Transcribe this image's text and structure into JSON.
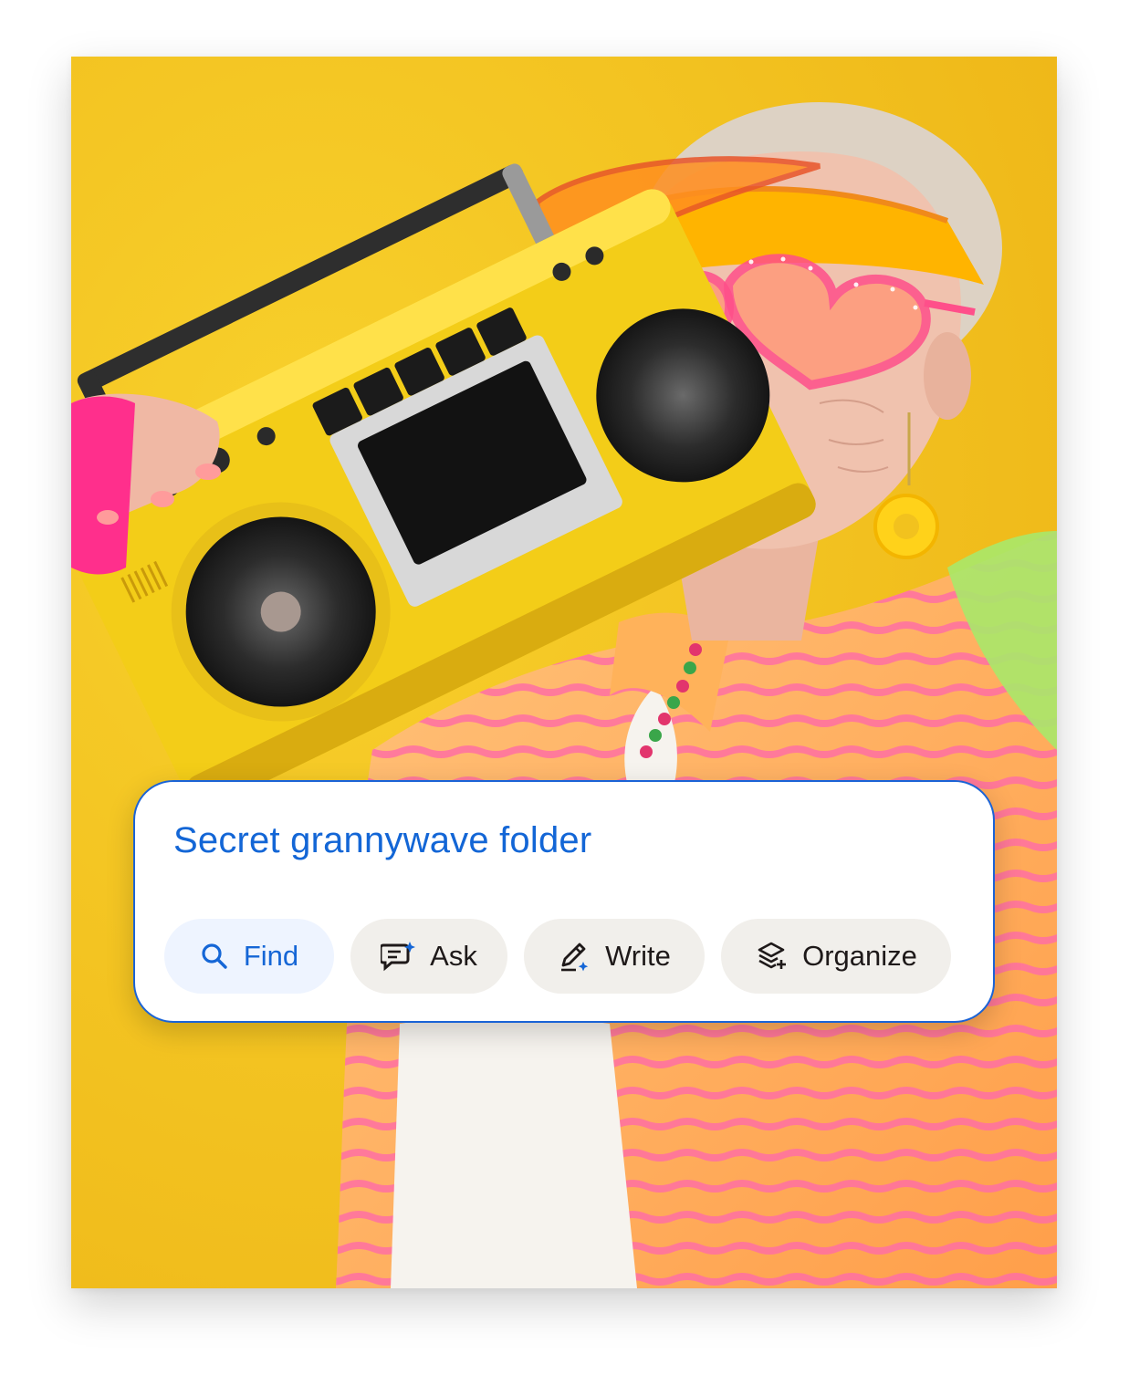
{
  "search": {
    "query": "Secret grannywave folder"
  },
  "actions": [
    {
      "label": "Find",
      "icon": "search-icon",
      "selected": true
    },
    {
      "label": "Ask",
      "icon": "chat-sparkle-icon",
      "selected": false
    },
    {
      "label": "Write",
      "icon": "pencil-sparkle-icon",
      "selected": false
    },
    {
      "label": "Organize",
      "icon": "layers-plus-icon",
      "selected": false
    }
  ],
  "colors": {
    "accent": "#1366d6",
    "photo_background": "#f2c21e",
    "chip_background": "#f1efeb",
    "selected_chip_background": "#eef4ff"
  }
}
